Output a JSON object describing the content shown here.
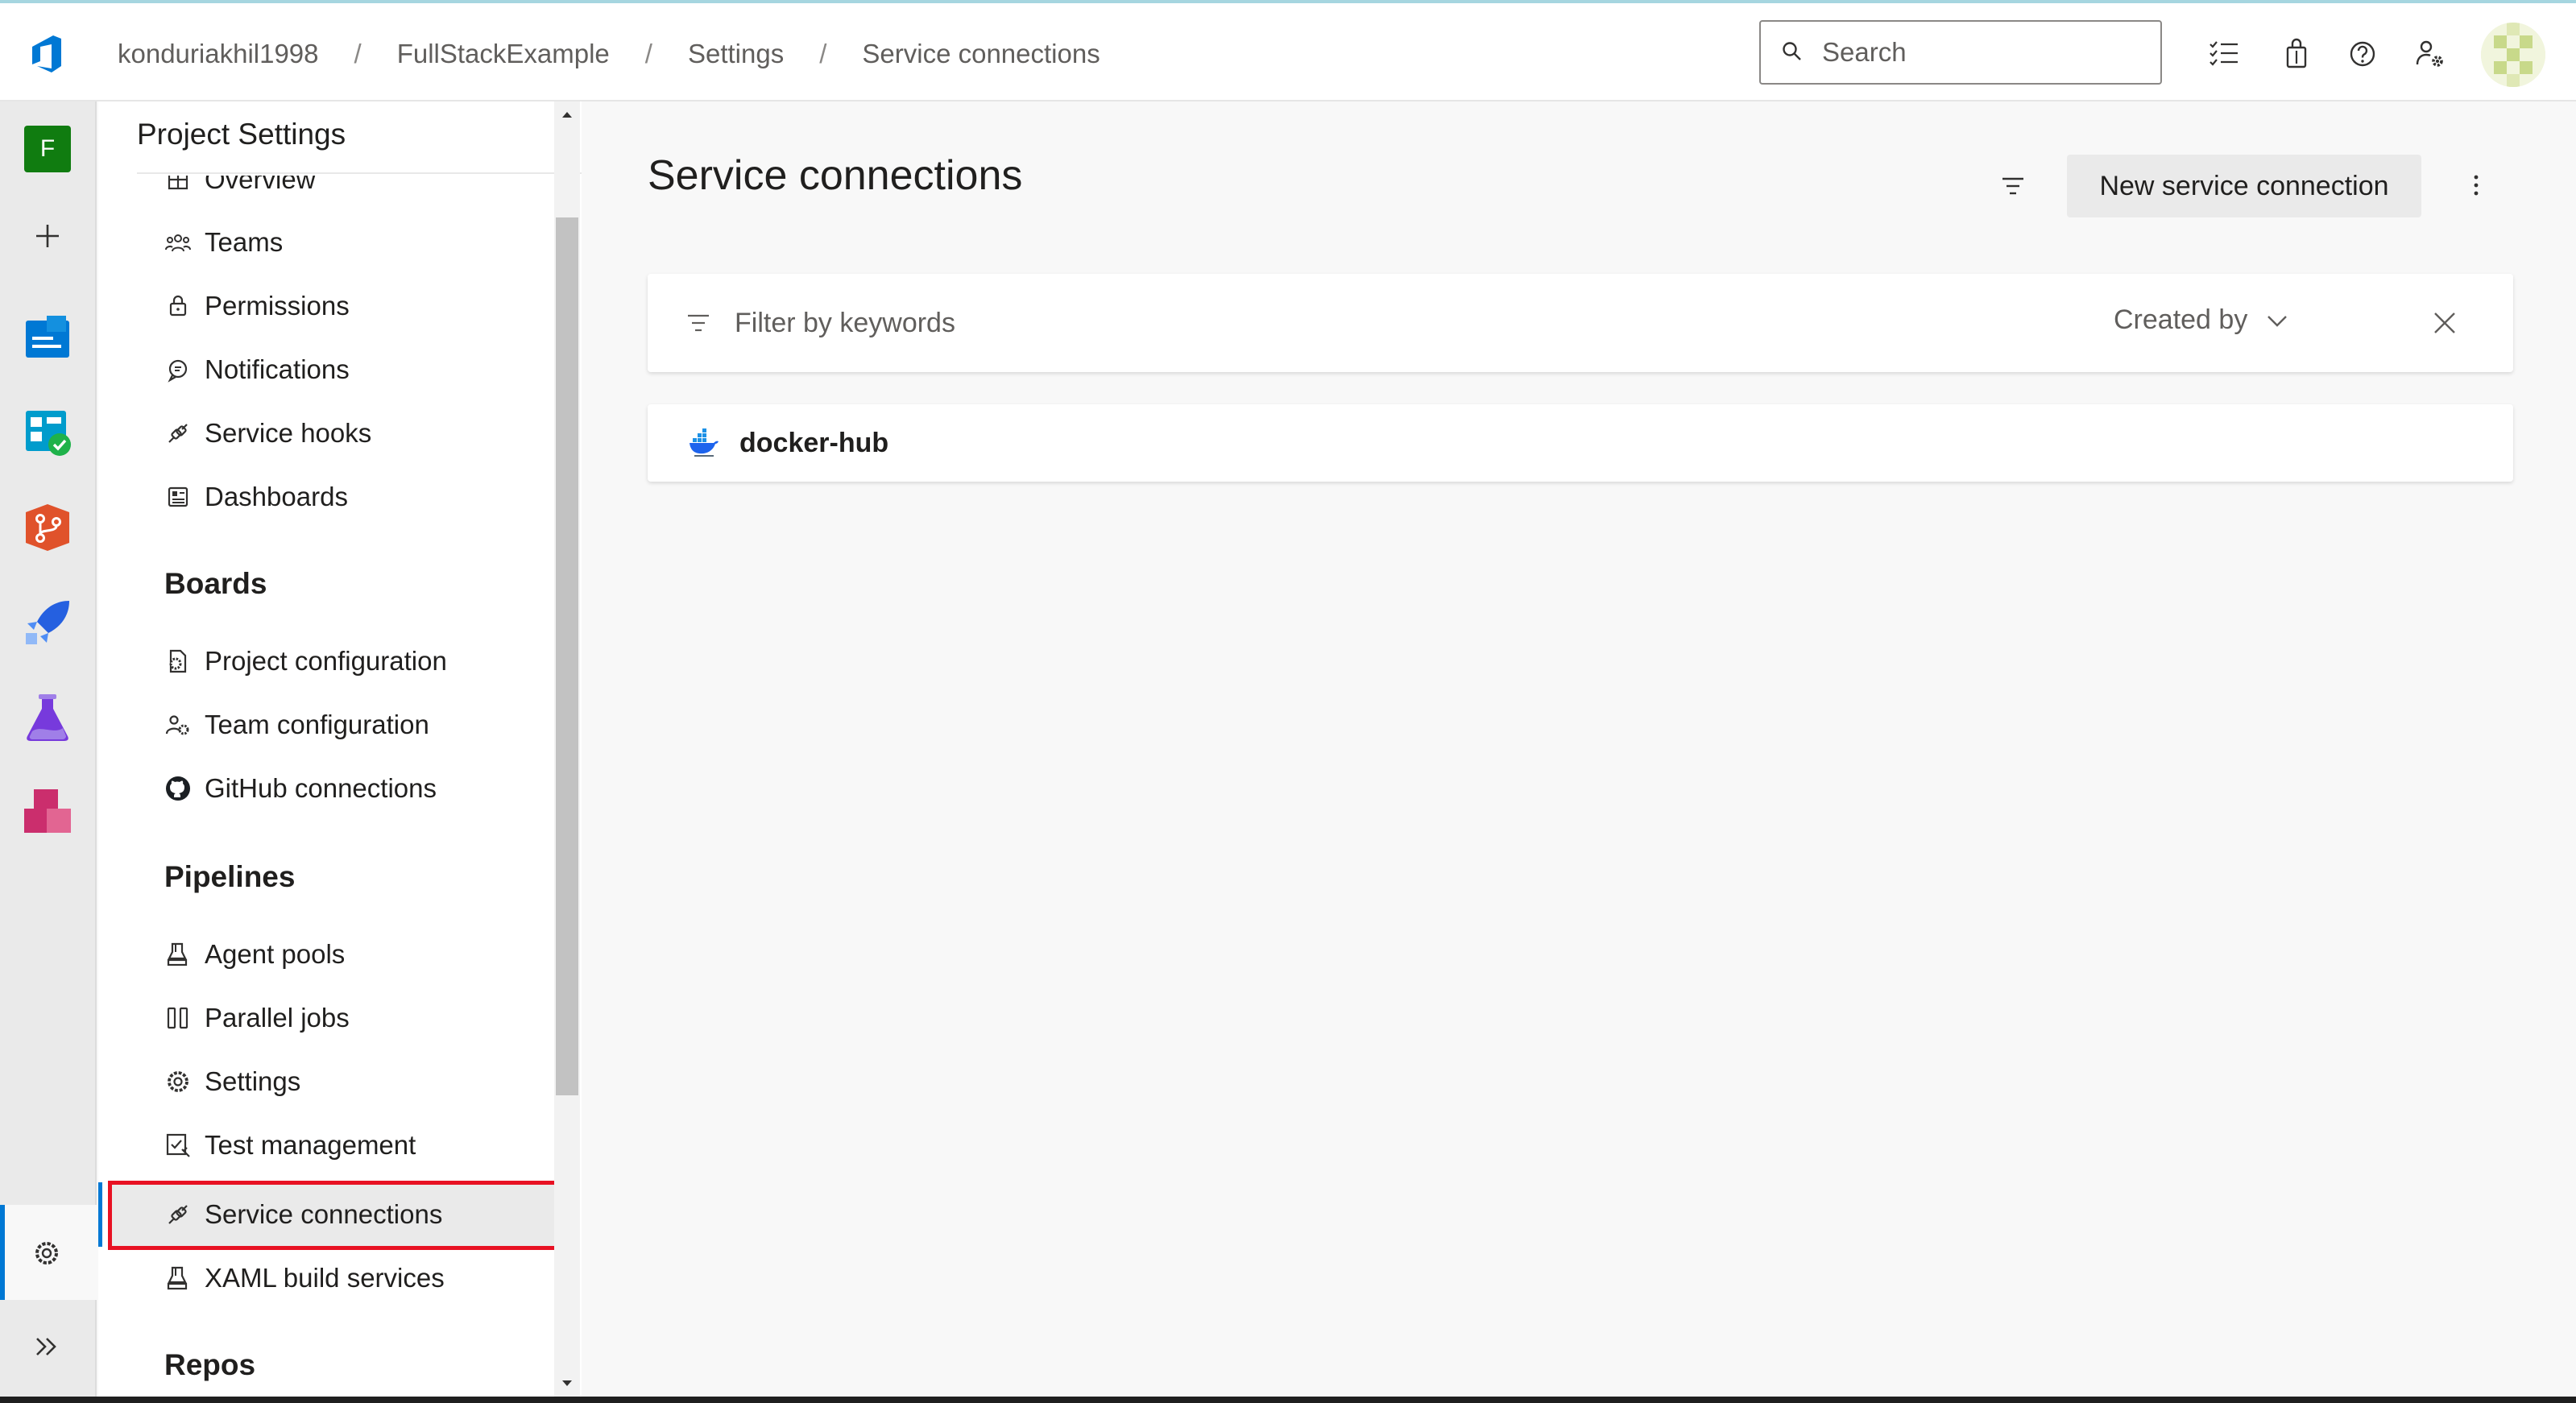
{
  "breadcrumb": {
    "items": [
      "konduriakhil1998",
      "FullStackExample",
      "Settings",
      "Service connections"
    ],
    "separator": "/"
  },
  "search": {
    "placeholder": "Search"
  },
  "header_icons": [
    "checklist-icon",
    "shopping-bag-icon",
    "help-icon",
    "user-settings-icon"
  ],
  "project": {
    "initial": "F",
    "color": "#107c10"
  },
  "rail": {
    "items": [
      "project-icon",
      "add-icon",
      "overview-icon",
      "boards-icon",
      "repos-icon",
      "pipelines-icon",
      "test-plans-icon",
      "artifacts-icon"
    ],
    "bottom": [
      "settings-icon",
      "expand-icon"
    ]
  },
  "sidebar": {
    "title": "Project Settings",
    "general": [
      {
        "label": "Overview",
        "icon": "overview-icon"
      },
      {
        "label": "Teams",
        "icon": "teams-icon"
      },
      {
        "label": "Permissions",
        "icon": "lock-icon"
      },
      {
        "label": "Notifications",
        "icon": "chat-icon"
      },
      {
        "label": "Service hooks",
        "icon": "plug-icon"
      },
      {
        "label": "Dashboards",
        "icon": "dashboard-icon"
      }
    ],
    "boards_heading": "Boards",
    "boards": [
      {
        "label": "Project configuration",
        "icon": "config-icon"
      },
      {
        "label": "Team configuration",
        "icon": "team-config-icon"
      },
      {
        "label": "GitHub connections",
        "icon": "github-icon"
      }
    ],
    "pipelines_heading": "Pipelines",
    "pipelines": [
      {
        "label": "Agent pools",
        "icon": "agent-icon"
      },
      {
        "label": "Parallel jobs",
        "icon": "parallel-icon"
      },
      {
        "label": "Settings",
        "icon": "gear-icon"
      },
      {
        "label": "Test management",
        "icon": "test-icon"
      },
      {
        "label": "Service connections",
        "icon": "plug-icon",
        "selected": true
      },
      {
        "label": "XAML build services",
        "icon": "agent-icon"
      }
    ],
    "repos_heading": "Repos"
  },
  "main": {
    "title": "Service connections",
    "new_button": "New service connection",
    "filter": {
      "placeholder": "Filter by keywords",
      "created_by": "Created by"
    },
    "connections": [
      {
        "name": "docker-hub",
        "type": "docker"
      }
    ]
  },
  "colors": {
    "accent": "#0078d4",
    "highlight": "#e81123"
  }
}
